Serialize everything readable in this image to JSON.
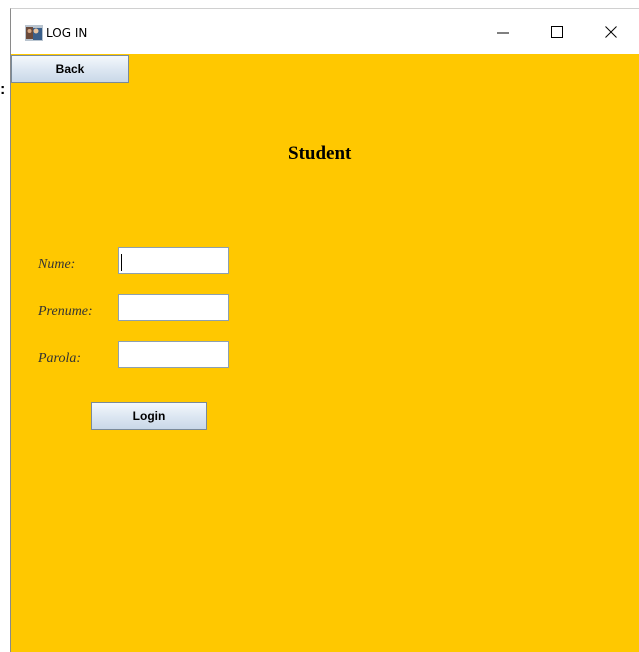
{
  "window": {
    "title": "LOG IN"
  },
  "toolbar": {
    "back_label": "Back"
  },
  "form": {
    "heading": "Student",
    "fields": [
      {
        "label": "Nume:",
        "value": ""
      },
      {
        "label": "Prenume:",
        "value": ""
      },
      {
        "label": "Parola:",
        "value": ""
      }
    ],
    "login_label": "Login"
  },
  "colors": {
    "content_background": "#ffc800"
  },
  "icons": {
    "app": "java-app-icon",
    "minimize": "minimize-icon",
    "maximize": "maximize-icon",
    "close": "close-icon"
  }
}
